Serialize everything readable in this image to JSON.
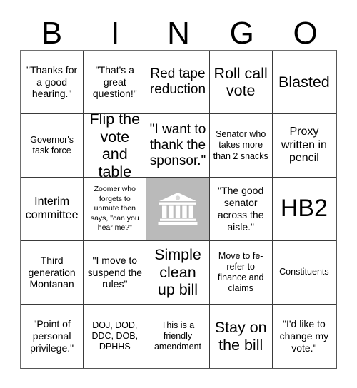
{
  "card": {
    "title": "BINGO",
    "header_letters": [
      "B",
      "I",
      "N",
      "G",
      "O"
    ],
    "free_space": {
      "icon": "classical-building-icon",
      "label": "",
      "background_color": "#bababa",
      "icon_color": "#ffffff"
    },
    "colors": {
      "page_background": "#ffffff",
      "cell_background": "#ffffff",
      "text": "#000000",
      "grid_line": "#3a3a3a",
      "free_space_background": "#bababa"
    },
    "grid_size": "5x5",
    "rows": [
      [
        {
          "text": "\"Thanks for a good hearing.\"",
          "size": "sm"
        },
        {
          "text": "\"That's a great question!\"",
          "size": "sm"
        },
        {
          "text": "Red tape reduction",
          "size": "lg"
        },
        {
          "text": "Roll call vote",
          "size": "xl"
        },
        {
          "text": "Blasted",
          "size": "xl"
        }
      ],
      [
        {
          "text": "Governor's task force",
          "size": "xs"
        },
        {
          "text": "Flip the vote and table",
          "size": "xl"
        },
        {
          "text": "\"I want to thank the sponsor.\"",
          "size": "lg"
        },
        {
          "text": "Senator who takes more than 2 snacks",
          "size": "xs"
        },
        {
          "text": "Proxy written in pencil",
          "size": "md"
        }
      ],
      [
        {
          "text": "Interim committee",
          "size": "md"
        },
        {
          "text": "Zoomer who forgets to unmute then says, \"can you hear me?\"",
          "size": "xxs"
        },
        {
          "text": "",
          "size": "md",
          "free": true
        },
        {
          "text": "\"The good senator across the aisle.\"",
          "size": "sm"
        },
        {
          "text": "HB2",
          "size": "xxl"
        }
      ],
      [
        {
          "text": "Third generation Montanan",
          "size": "sm"
        },
        {
          "text": "\"I move to suspend the rules\"",
          "size": "sm"
        },
        {
          "text": "Simple clean up bill",
          "size": "xl"
        },
        {
          "text": "Move to fe-refer to finance and claims",
          "size": "xs"
        },
        {
          "text": "Constituents",
          "size": "xs"
        }
      ],
      [
        {
          "text": "\"Point of personal privilege.\"",
          "size": "sm"
        },
        {
          "text": "DOJ, DOD, DDC, DOB, DPHHS",
          "size": "xs"
        },
        {
          "text": "This is a friendly amendment",
          "size": "xs"
        },
        {
          "text": "Stay on the bill",
          "size": "xl"
        },
        {
          "text": "\"I'd like to change my vote.\"",
          "size": "sm"
        }
      ]
    ]
  }
}
